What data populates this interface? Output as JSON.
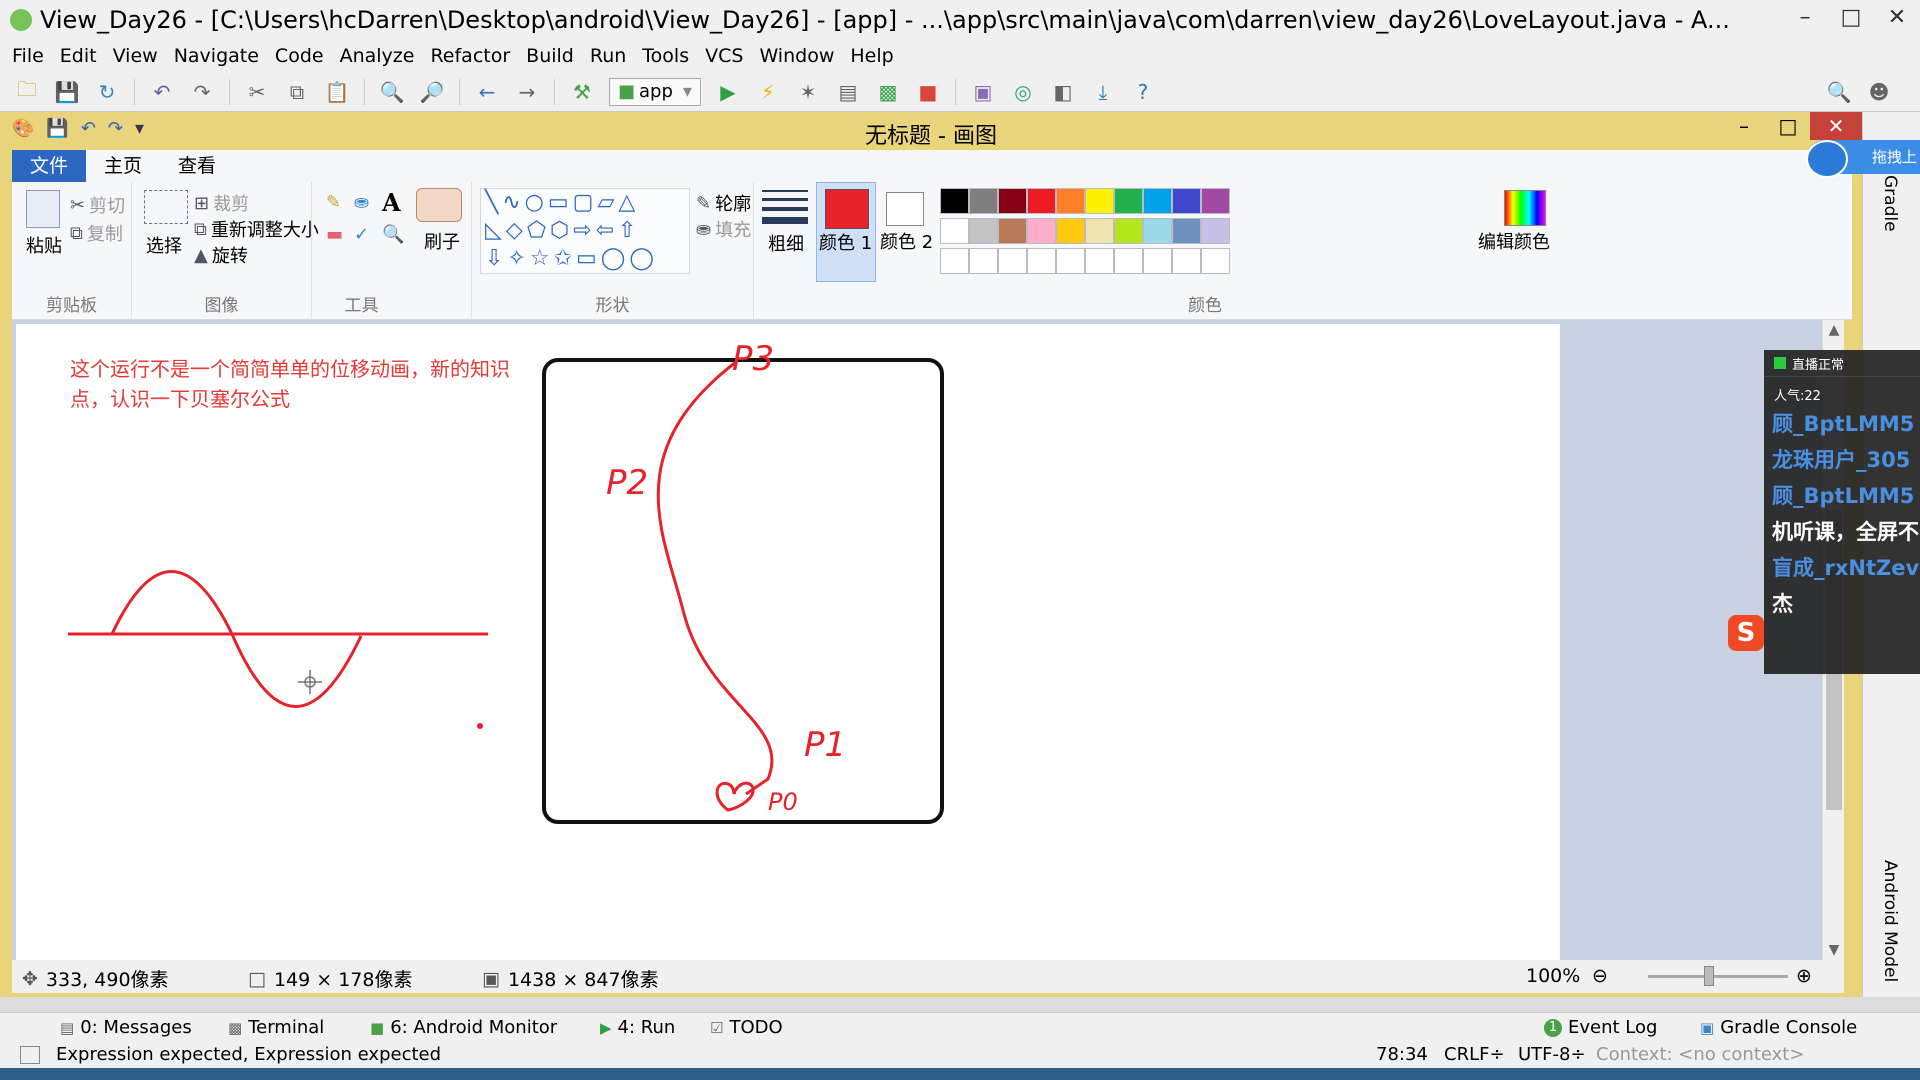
{
  "ide": {
    "title": "View_Day26 - [C:\\Users\\hcDarren\\Desktop\\android\\View_Day26] - [app] - ...\\app\\src\\main\\java\\com\\darren\\view_day26\\LoveLayout.java - A...",
    "menu": [
      "File",
      "Edit",
      "View",
      "Navigate",
      "Code",
      "Analyze",
      "Refactor",
      "Build",
      "Run",
      "Tools",
      "VCS",
      "Window",
      "Help"
    ],
    "run_config": "app",
    "tool_tabs": {
      "messages": "0: Messages",
      "terminal": "Terminal",
      "android_monitor": "6: Android Monitor",
      "run": "4: Run",
      "todo": "TODO",
      "event_log": "Event Log",
      "event_log_count": "1",
      "gradle_console": "Gradle Console"
    },
    "status": {
      "message": "Expression expected, Expression expected",
      "position": "78:34",
      "line_sep": "CRLF÷",
      "encoding": "UTF-8÷",
      "context": "Context: <no context>"
    },
    "side_tabs": {
      "gradle": "Gradle",
      "android_model": "Android Model"
    }
  },
  "paint": {
    "title": "无标题 - 画图",
    "tabs": {
      "file": "文件",
      "home": "主页",
      "view": "查看"
    },
    "clipboard": {
      "paste": "粘贴",
      "cut": "剪切",
      "copy": "复制",
      "group": "剪贴板"
    },
    "image": {
      "select": "选择",
      "crop": "裁剪",
      "resize": "重新调整大小",
      "rotate": "旋转",
      "group": "图像"
    },
    "tools": {
      "group": "工具",
      "brush": "刷子"
    },
    "shapes": {
      "outline": "轮廓",
      "fill": "填充",
      "group": "形状"
    },
    "size_label": "粗细",
    "colors": {
      "color1": "颜色 1",
      "color2": "颜色 2",
      "edit": "编辑颜色",
      "group": "颜色",
      "color1_value": "#e8222b",
      "color2_value": "#ffffff",
      "palette_row1": [
        "#000000",
        "#7f7f7f",
        "#880015",
        "#ed1c24",
        "#ff7f27",
        "#fff200",
        "#22b14c",
        "#00a2e8",
        "#3f48cc",
        "#a349a4"
      ],
      "palette_row2": [
        "#ffffff",
        "#c3c3c3",
        "#b97a57",
        "#ffaec9",
        "#ffc90e",
        "#efe4b0",
        "#b5e61d",
        "#99d9ea",
        "#7092be",
        "#c8bfe7"
      ]
    },
    "canvas_note": "这个运行不是一个简简单单的位移动画，新的知识点，认识一下贝塞尔公式",
    "sketch_labels": {
      "p3": "P3",
      "p2": "P2",
      "p1": "P1",
      "p0": "P0"
    },
    "ink_color": "#e8222b",
    "status": {
      "cursor": "333, 490像素",
      "selection": "149 × 178像素",
      "image_size": "1438 × 847像素",
      "zoom": "100%"
    }
  },
  "overlays": {
    "cloud_badge": "拖拽上",
    "live": {
      "status": "直播正常",
      "popularity": "人气:22",
      "messages": [
        "顾_BptLMM5",
        "龙珠用户_305",
        "顾_BptLMM5",
        "机听课，全屏不",
        "盲成_rxNtZev",
        "杰"
      ]
    },
    "ime_logo": "S"
  }
}
